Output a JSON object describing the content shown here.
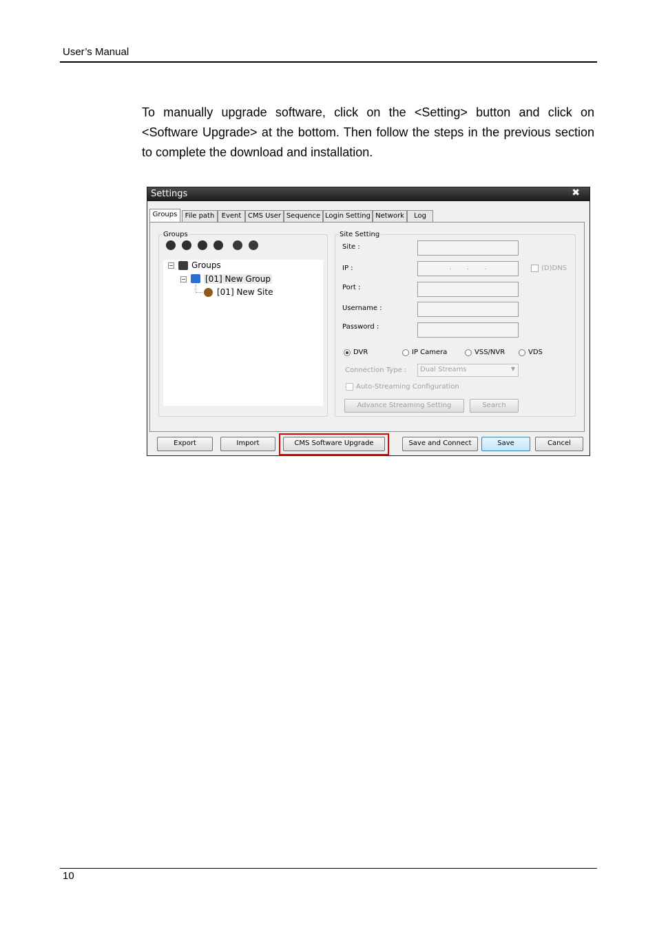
{
  "header": {
    "title": "User’s Manual"
  },
  "body": {
    "paragraph": "To manually upgrade software, click on the <Setting> button and click on <Software Upgrade> at the bottom. Then follow the steps in the previous section to complete the download and installation."
  },
  "footer": {
    "page_number": "10"
  },
  "dialog": {
    "title": "Settings",
    "close_glyph": "✖",
    "tabs": [
      "Groups",
      "File path",
      "Event",
      "CMS User",
      "Sequence",
      "Login Setting",
      "Network",
      "Log"
    ],
    "groups_panel": {
      "legend": "Groups",
      "tree": {
        "root": "Groups",
        "group": "[01] New Group",
        "site": "[01] New Site"
      }
    },
    "site_setting": {
      "legend": "Site Setting",
      "site_label": "Site :",
      "ip_label": "IP :",
      "ip_dots": ".        .        .",
      "ddns_label": "(D)DNS",
      "port_label": "Port :",
      "username_label": "Username :",
      "password_label": "Password :",
      "device_types": [
        "DVR",
        "IP Camera",
        "VSS/NVR",
        "VDS"
      ],
      "connection_type_label": "Connection Type :",
      "connection_type_value": "Dual Streams",
      "auto_streaming_label": "Auto-Streaming Configuration",
      "advance_button": "Advance Streaming Setting",
      "search_button": "Search"
    },
    "buttons": {
      "export": "Export",
      "import": "Import",
      "upgrade": "CMS Software Upgrade",
      "save_connect": "Save and Connect",
      "save": "Save",
      "cancel": "Cancel"
    }
  }
}
